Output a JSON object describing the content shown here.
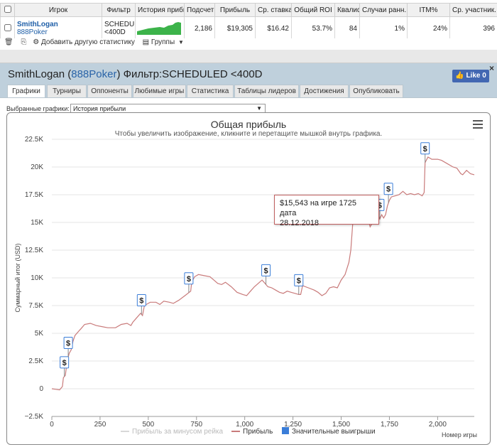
{
  "stats_table": {
    "headers": [
      "Игрок",
      "Фильтр",
      "История прибыли",
      "Подсчет",
      "Прибыль",
      "Ср. ставка",
      "Общий ROI",
      "Квалиф.",
      "Случаи ранн.",
      "ITM%",
      "Ср. участник."
    ],
    "row": {
      "player_name": "SmithLogan",
      "player_site": "888Poker",
      "filter_line1": "SCHEDULED",
      "filter_line2": "<400D",
      "count": "2,186",
      "profit": "$19,305",
      "avg_stake": "$16.42",
      "total_roi": "53.7%",
      "qual": "84",
      "early": "1%",
      "itm": "24%",
      "avg_entrants": "396"
    }
  },
  "toolbar": {
    "add_stat": "Добавить другую статистику",
    "groups": "Группы"
  },
  "panel": {
    "player": "SmithLogan",
    "site": "888Poker",
    "filter": "Фильтр:SCHEDULED <400D",
    "like": "Like 0",
    "close": "×"
  },
  "tabs": [
    "Графики",
    "Турниры",
    "Оппоненты",
    "Любимые игры",
    "Статистика",
    "Таблицы лидеров",
    "Достижения",
    "Опубликовать"
  ],
  "selector": {
    "label": "Выбранные графики:",
    "value": "История прибыли"
  },
  "chart_data": {
    "type": "line",
    "title": "Общая прибыль",
    "subtitle": "Чтобы увеличить изображение, кликните и перетащите мышкой внутрь графика.",
    "ylabel": "Суммарный итог (USD)",
    "xlabel": "Номер игры",
    "x_ticks": [
      "0",
      "250",
      "500",
      "750",
      "1,000",
      "1,250",
      "1,500",
      "1,750",
      "2,000"
    ],
    "y_ticks": [
      "−2.5K",
      "0",
      "2.5K",
      "5K",
      "7.5K",
      "10K",
      "12.5K",
      "15K",
      "17.5K",
      "20K",
      "22.5K"
    ],
    "xlim": [
      0,
      2190
    ],
    "ylim": [
      -2500,
      22500
    ],
    "series": [
      {
        "name": "Прибыль",
        "color": "#c97b7b",
        "points": [
          [
            0,
            0
          ],
          [
            20,
            -50
          ],
          [
            40,
            -100
          ],
          [
            55,
            200
          ],
          [
            60,
            1000
          ],
          [
            70,
            1200
          ],
          [
            80,
            2500
          ],
          [
            90,
            3200
          ],
          [
            100,
            3500
          ],
          [
            110,
            4300
          ],
          [
            120,
            4800
          ],
          [
            140,
            5200
          ],
          [
            150,
            5400
          ],
          [
            170,
            5800
          ],
          [
            200,
            5900
          ],
          [
            230,
            5700
          ],
          [
            260,
            5600
          ],
          [
            290,
            5500
          ],
          [
            330,
            5500
          ],
          [
            360,
            5800
          ],
          [
            390,
            5900
          ],
          [
            410,
            5700
          ],
          [
            420,
            6000
          ],
          [
            440,
            6400
          ],
          [
            460,
            6800
          ],
          [
            470,
            6600
          ],
          [
            480,
            7500
          ],
          [
            490,
            7600
          ],
          [
            510,
            7800
          ],
          [
            540,
            7800
          ],
          [
            560,
            7600
          ],
          [
            580,
            7900
          ],
          [
            610,
            7800
          ],
          [
            630,
            7700
          ],
          [
            660,
            8000
          ],
          [
            690,
            8400
          ],
          [
            720,
            8800
          ],
          [
            725,
            9600
          ],
          [
            740,
            10100
          ],
          [
            760,
            10300
          ],
          [
            790,
            10200
          ],
          [
            820,
            10100
          ],
          [
            840,
            9800
          ],
          [
            860,
            9500
          ],
          [
            880,
            9400
          ],
          [
            900,
            9600
          ],
          [
            930,
            9200
          ],
          [
            960,
            8700
          ],
          [
            990,
            8500
          ],
          [
            1010,
            8400
          ],
          [
            1030,
            8800
          ],
          [
            1050,
            9200
          ],
          [
            1070,
            9500
          ],
          [
            1090,
            9800
          ],
          [
            1100,
            9600
          ],
          [
            1120,
            9200
          ],
          [
            1140,
            9100
          ],
          [
            1160,
            8900
          ],
          [
            1180,
            8700
          ],
          [
            1200,
            8600
          ],
          [
            1220,
            8800
          ],
          [
            1240,
            8700
          ],
          [
            1260,
            8600
          ],
          [
            1280,
            8500
          ],
          [
            1290,
            8500
          ],
          [
            1300,
            9300
          ],
          [
            1330,
            9100
          ],
          [
            1360,
            8900
          ],
          [
            1380,
            8700
          ],
          [
            1400,
            8400
          ],
          [
            1420,
            8600
          ],
          [
            1440,
            9100
          ],
          [
            1460,
            9200
          ],
          [
            1480,
            9100
          ],
          [
            1500,
            9800
          ],
          [
            1520,
            10300
          ],
          [
            1540,
            11400
          ],
          [
            1550,
            12500
          ],
          [
            1560,
            14900
          ],
          [
            1580,
            15400
          ],
          [
            1600,
            15600
          ],
          [
            1620,
            15900
          ],
          [
            1640,
            15300
          ],
          [
            1650,
            14600
          ],
          [
            1660,
            14900
          ],
          [
            1680,
            16200
          ],
          [
            1700,
            15300
          ],
          [
            1710,
            15700
          ],
          [
            1720,
            15400
          ],
          [
            1730,
            15700
          ],
          [
            1740,
            16500
          ],
          [
            1750,
            17000
          ],
          [
            1760,
            17300
          ],
          [
            1780,
            17400
          ],
          [
            1800,
            17500
          ],
          [
            1820,
            17800
          ],
          [
            1840,
            17500
          ],
          [
            1860,
            17600
          ],
          [
            1880,
            17500
          ],
          [
            1900,
            17600
          ],
          [
            1920,
            17400
          ],
          [
            1930,
            17700
          ],
          [
            1935,
            20400
          ],
          [
            1950,
            20900
          ],
          [
            1970,
            20700
          ],
          [
            2000,
            20700
          ],
          [
            2020,
            20600
          ],
          [
            2050,
            20300
          ],
          [
            2080,
            20000
          ],
          [
            2100,
            19900
          ],
          [
            2120,
            19400
          ],
          [
            2130,
            19300
          ],
          [
            2150,
            19700
          ],
          [
            2170,
            19400
          ],
          [
            2190,
            19300
          ]
        ]
      }
    ],
    "significant_wins": [
      65,
      85,
      465,
      710,
      1110,
      1280,
      1560,
      1700,
      1745,
      1935
    ],
    "legend": [
      "Прибыль за минусом рейка",
      "Прибыль",
      "Значительные выигрыши"
    ],
    "legend_colors": [
      "#d8d8d8",
      "#c97b7b",
      "#3a7dd8"
    ],
    "legend_position": "bottom",
    "tooltip_line1": "$15,543 на игре 1725 дата",
    "tooltip_line2": "28.12.2018"
  }
}
